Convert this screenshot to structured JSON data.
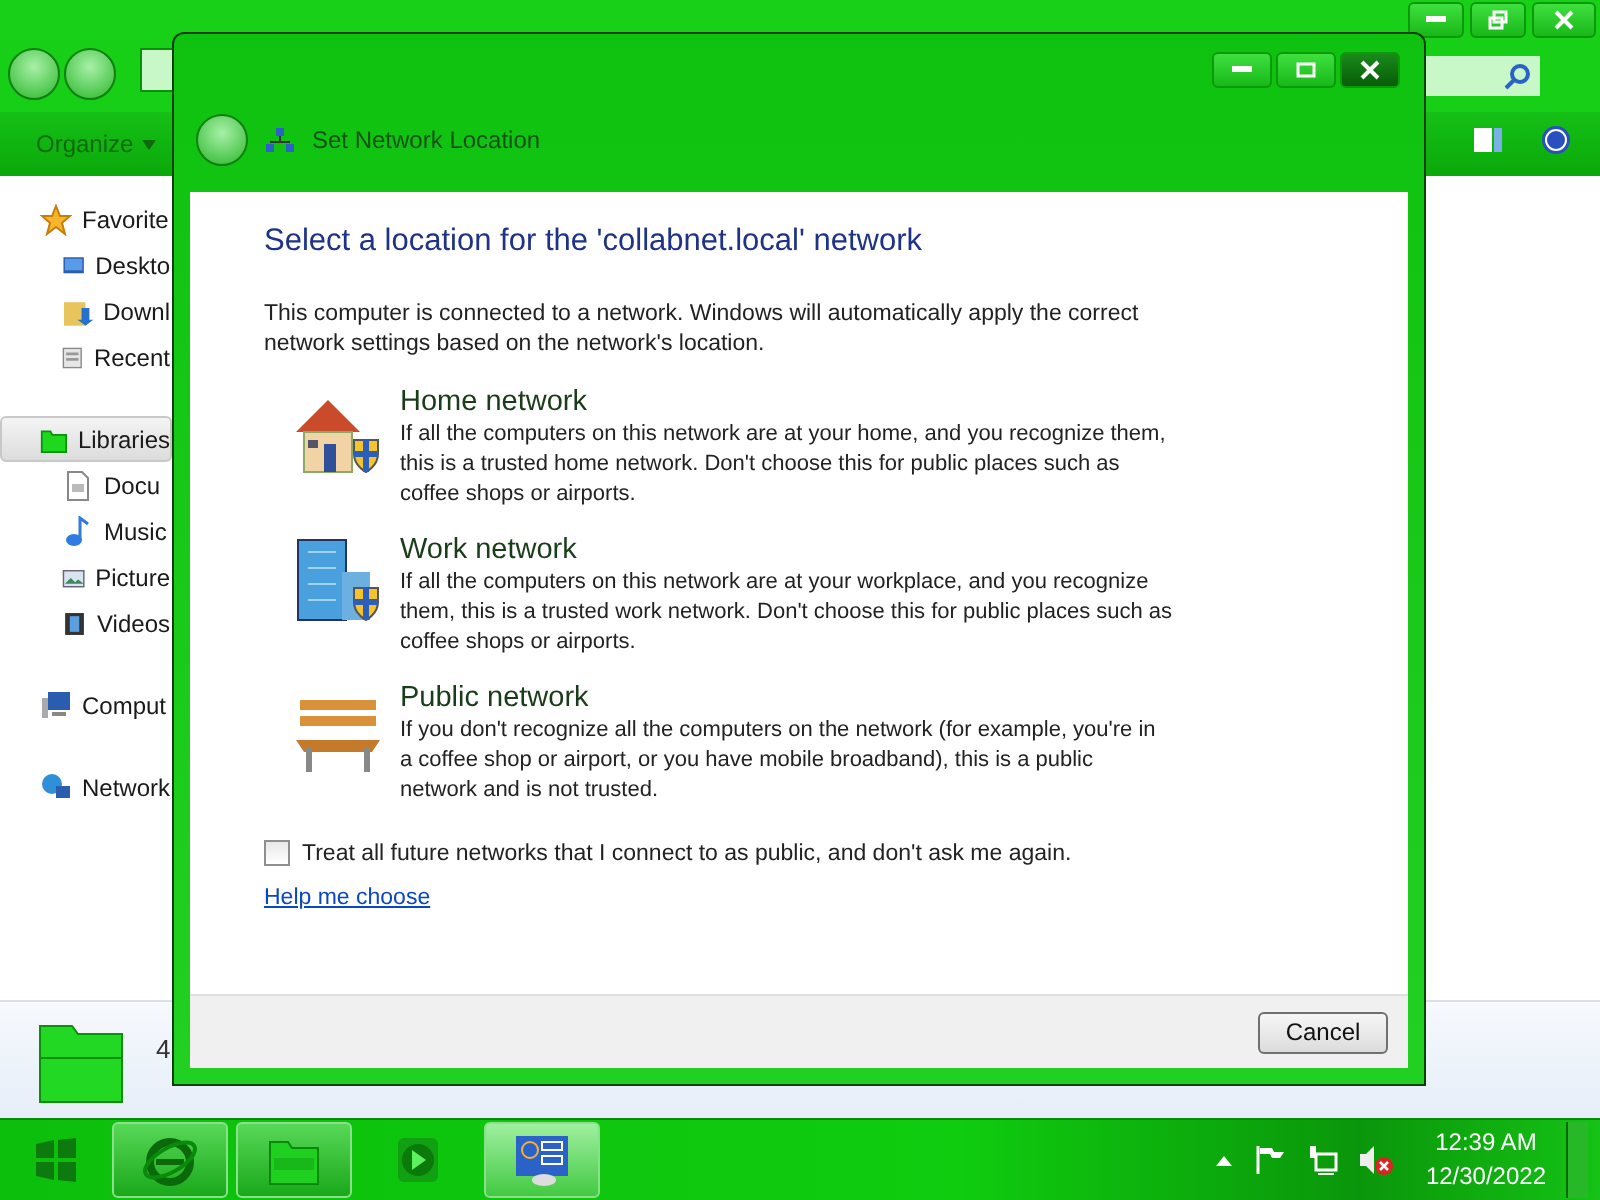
{
  "explorer": {
    "organize": "Organize",
    "nav": [
      {
        "label": "Favorite",
        "kind": "star",
        "selected": false,
        "children": [
          {
            "label": "Deskto",
            "kind": "desktop",
            "selected": false
          },
          {
            "label": "Downl",
            "kind": "download",
            "selected": false
          },
          {
            "label": "Recent",
            "kind": "recent",
            "selected": false
          }
        ]
      },
      {
        "label": "Libraries",
        "kind": "folder",
        "selected": true,
        "children": [
          {
            "label": "Docu",
            "kind": "doc",
            "selected": false
          },
          {
            "label": "Music",
            "kind": "music",
            "selected": false
          },
          {
            "label": "Picture",
            "kind": "picture",
            "selected": false
          },
          {
            "label": "Videos",
            "kind": "video",
            "selected": false
          }
        ]
      },
      {
        "label": "Comput",
        "kind": "computer",
        "selected": false
      },
      {
        "label": "Network",
        "kind": "network",
        "selected": false
      }
    ],
    "details": {
      "count": "4"
    }
  },
  "dialog": {
    "title": "Set Network Location",
    "heading": "Select a location for the 'collabnet.local' network",
    "intro": "This computer is connected to a network. Windows will automatically apply the correct\nnetwork settings based on the network's location.",
    "options": [
      {
        "kind": "home",
        "title": "Home network",
        "text": "If all the computers on this network are at your home, and you recognize them,\nthis is a trusted home network.  Don't choose this for public places such as\ncoffee shops or airports."
      },
      {
        "kind": "work",
        "title": "Work network",
        "text": "If all the computers on this network are at your workplace, and you recognize\nthem, this is a trusted work network.  Don't choose this for public places such as\ncoffee shops or airports."
      },
      {
        "kind": "public",
        "title": "Public network",
        "text": "If you don't recognize all the computers on the network (for example, you're in\na coffee shop or airport, or you have mobile broadband), this is a public\nnetwork and is not trusted."
      }
    ],
    "checkbox": {
      "label": "Treat all future networks that I connect to as public, and don't ask me again.",
      "checked": false
    },
    "help_link": "Help me choose",
    "cancel": "Cancel"
  },
  "taskbar": {
    "apps": [
      {
        "kind": "ie",
        "running": true,
        "selected": false
      },
      {
        "kind": "explorer",
        "running": true,
        "selected": false
      },
      {
        "kind": "media",
        "running": false,
        "selected": false
      },
      {
        "kind": "control",
        "running": true,
        "selected": true
      }
    ],
    "time": "12:39 AM",
    "date": "12/30/2022"
  }
}
